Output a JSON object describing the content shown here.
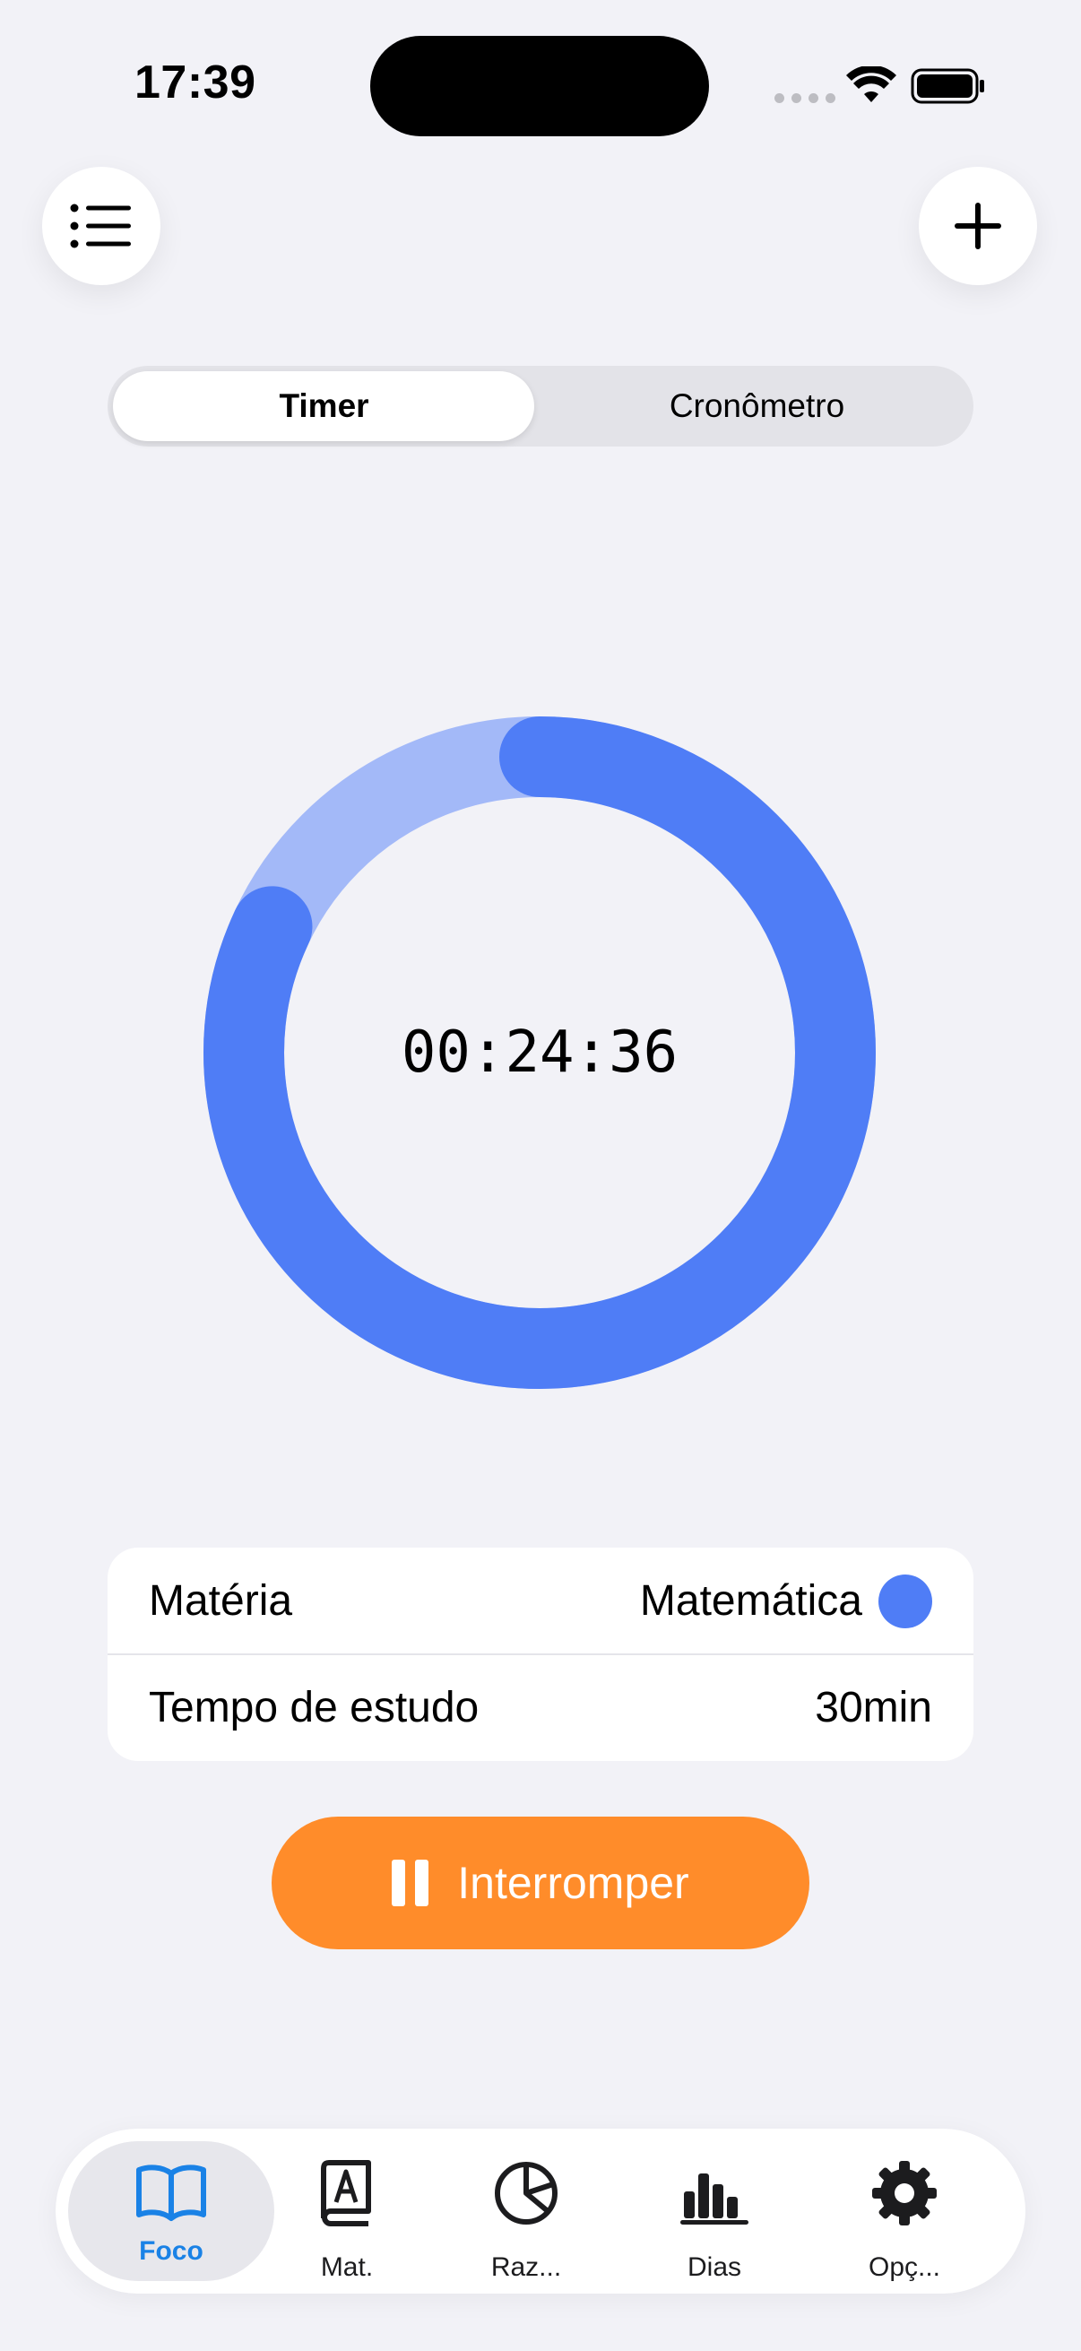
{
  "status_bar": {
    "time": "17:39"
  },
  "segmented": {
    "options": [
      "Timer",
      "Cronômetro"
    ],
    "selected": "Timer"
  },
  "timer": {
    "display": "00:24:36",
    "progress_elapsed_fraction": 0.18
  },
  "details": {
    "rows": [
      {
        "label": "Matéria",
        "value": "Matemática",
        "color": "#4F7DF6"
      },
      {
        "label": "Tempo de estudo",
        "value": "30min"
      }
    ]
  },
  "action": {
    "label": "Interromper",
    "color": "#FF8C2A"
  },
  "tabbar": {
    "selected": "Foco",
    "items": [
      {
        "label": "Foco",
        "icon": "book-open-icon"
      },
      {
        "label": "Mat.",
        "icon": "book-letter-a-icon"
      },
      {
        "label": "Raz...",
        "icon": "pie-chart-icon"
      },
      {
        "label": "Dias",
        "icon": "bar-chart-icon"
      },
      {
        "label": "Opç...",
        "icon": "gear-icon"
      }
    ]
  },
  "colors": {
    "background": "#F2F2F7",
    "accent_blue": "#4F7DF6",
    "ring_track": "#A3B9F8",
    "tab_active": "#1A82E6"
  }
}
